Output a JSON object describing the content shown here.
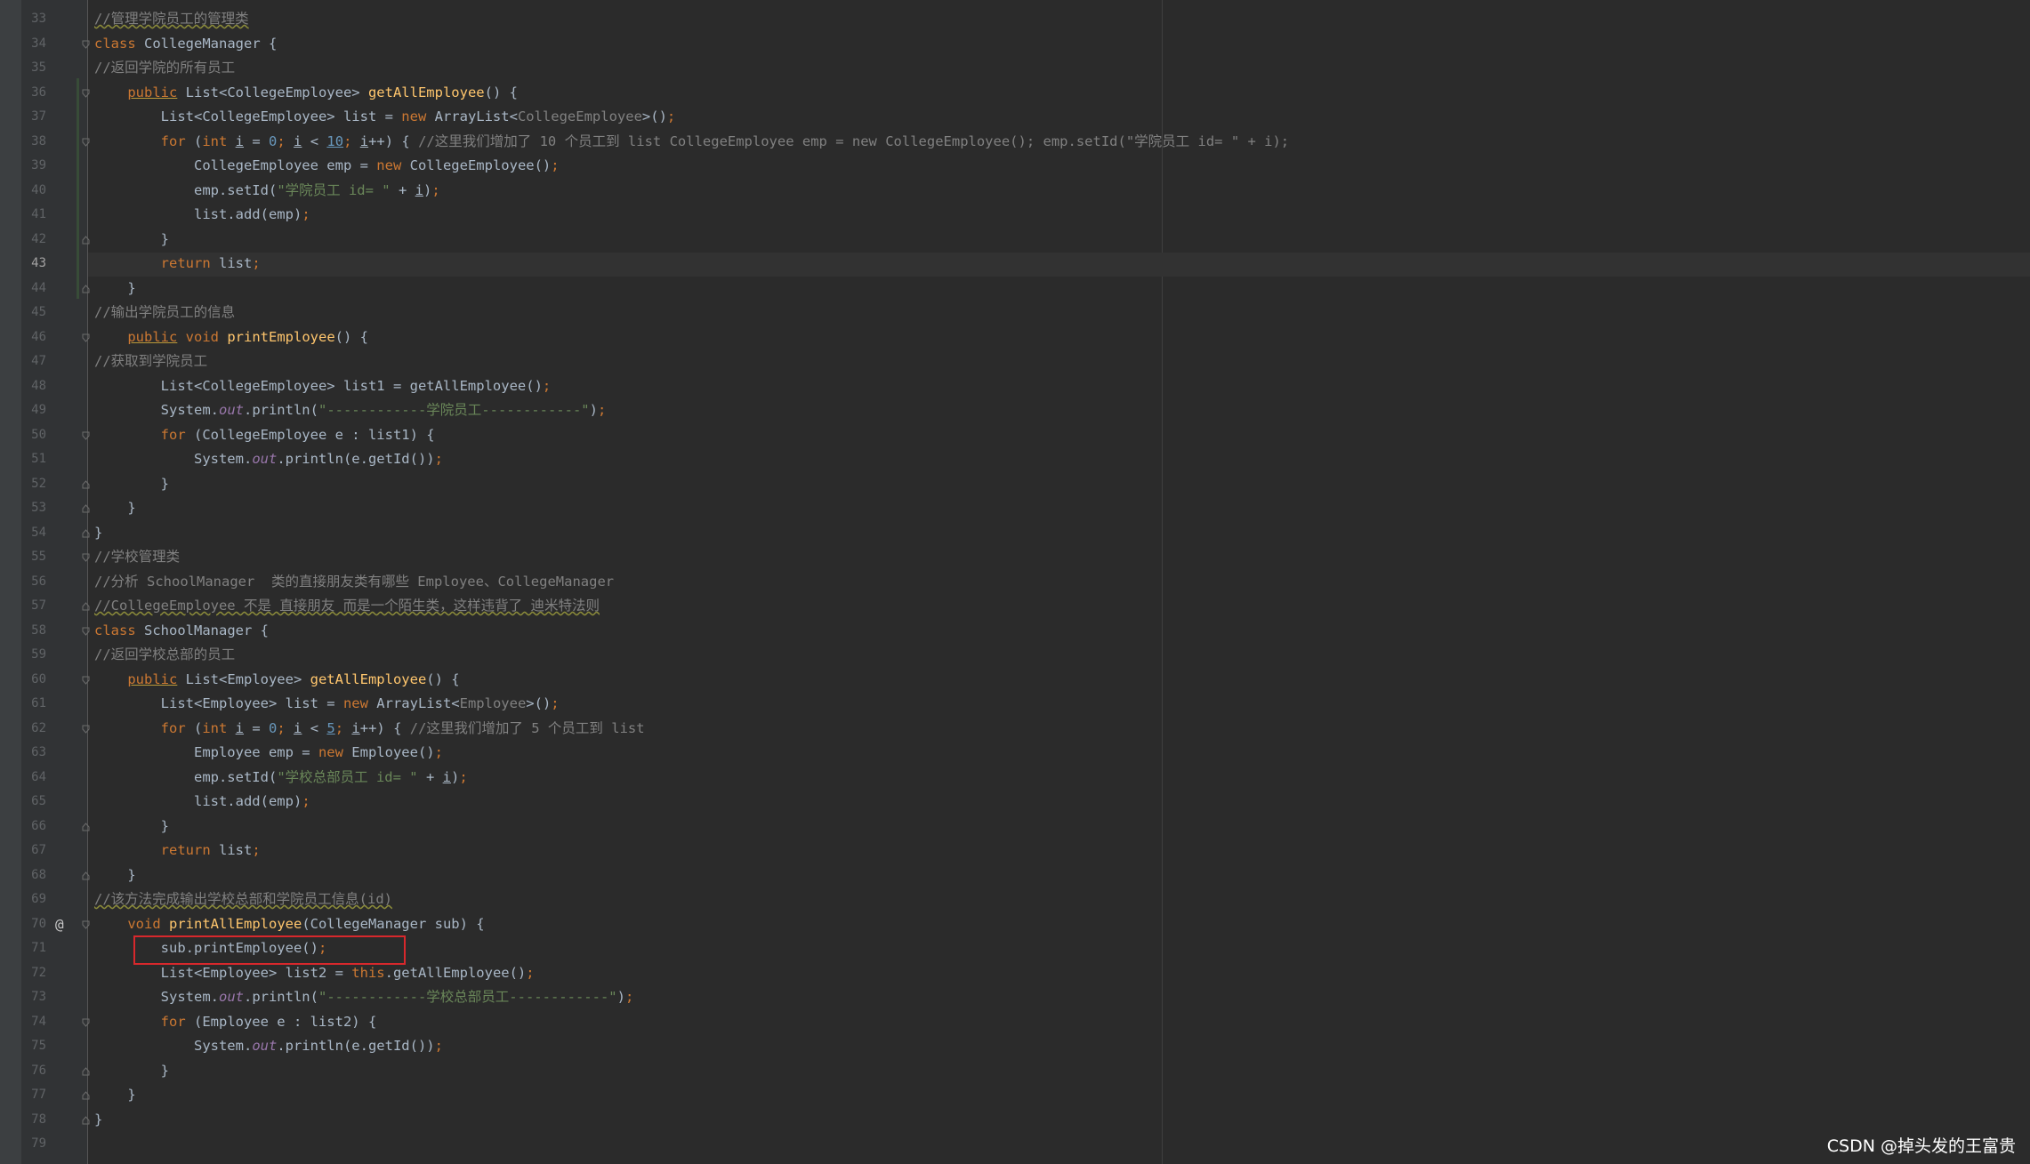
{
  "editor": {
    "active_line": "43",
    "watermark": "CSDN @掉头发的王富贵",
    "line_numbers": [
      "33",
      "34",
      "35",
      "36",
      "37",
      "38",
      "39",
      "40",
      "41",
      "42",
      "43",
      "44",
      "45",
      "46",
      "47",
      "48",
      "49",
      "50",
      "51",
      "52",
      "53",
      "54",
      "55",
      "56",
      "57",
      "58",
      "59",
      "60",
      "61",
      "62",
      "63",
      "64",
      "65",
      "66",
      "67",
      "68",
      "69",
      "70",
      "71",
      "72",
      "73",
      "74",
      "75",
      "76",
      "77",
      "78",
      "79"
    ],
    "gutter_marker_line70": "@",
    "code": {
      "l33": "//管理学院员工的管理类",
      "l34_kw": "class",
      "l34_rest": " CollegeManager {",
      "l35": "//返回学院的所有员工",
      "l36_kw": "public",
      "l36_type": " List<CollegeEmployee> ",
      "l36_fn": "getAllEmployee",
      "l36_rest": "() {",
      "l37_a": "List<CollegeEmployee> list = ",
      "l37_kw": "new",
      "l37_b": " ArrayList<",
      "l37_gen": "CollegeEmployee",
      "l37_c": ">()",
      "l37_semi": ";",
      "l38_kw1": "for",
      "l38_a": " (",
      "l38_kw2": "int",
      "l38_var1": "i",
      "l38_b": " = ",
      "l38_n0": "0",
      "l38_semi1": ";",
      "l38_var2": "i",
      "l38_c": " < ",
      "l38_n10": "10",
      "l38_semi2": ";",
      "l38_var3": "i",
      "l38_d": "++) { ",
      "l38_cm": "//这里我们增加了 10 个员工到 list CollegeEmployee emp = new CollegeEmployee(); emp.setId(\"学院员工 id= \" + i);",
      "l39_a": "CollegeEmployee emp = ",
      "l39_kw": "new",
      "l39_b": " CollegeEmployee()",
      "l39_semi": ";",
      "l40_a": "emp.setId(",
      "l40_st": "\"学院员工 id= \"",
      "l40_b": " + ",
      "l40_var": "i",
      "l40_c": ")",
      "l40_semi": ";",
      "l41_a": "list.add(emp)",
      "l41_semi": ";",
      "l42": "}",
      "l43_kw": "return",
      "l43_a": " list",
      "l43_semi": ";",
      "l44": "}",
      "l45": "//输出学院员工的信息",
      "l46_kw1": "public",
      "l46_kw2": "void",
      "l46_fn": "printEmployee",
      "l46_rest": "() {",
      "l47": "//获取到学院员工",
      "l48_a": "List<CollegeEmployee> list1 = getAllEmployee()",
      "l48_semi": ";",
      "l49_a": "System.",
      "l49_fld": "out",
      "l49_b": ".println(",
      "l49_st": "\"------------学院员工------------\"",
      "l49_c": ")",
      "l49_semi": ";",
      "l50_kw": "for",
      "l50_rest": " (CollegeEmployee e : list1) {",
      "l51_a": "System.",
      "l51_fld": "out",
      "l51_b": ".println(e.getId())",
      "l51_semi": ";",
      "l52": "}",
      "l53": "}",
      "l54": "}",
      "l55": "//学校管理类",
      "l56": "//分析 SchoolManager  类的直接朋友类有哪些 Employee、CollegeManager",
      "l57": "//CollegeEmployee 不是 直接朋友 而是一个陌生类，这样违背了 迪米特法则",
      "l58_kw": "class",
      "l58_rest": " SchoolManager {",
      "l59": "//返回学校总部的员工",
      "l60_kw": "public",
      "l60_type": " List<Employee> ",
      "l60_fn": "getAllEmployee",
      "l60_rest": "() {",
      "l61_a": "List<Employee> list = ",
      "l61_kw": "new",
      "l61_b": " ArrayList<",
      "l61_gen": "Employee",
      "l61_c": ">()",
      "l61_semi": ";",
      "l62_kw1": "for",
      "l62_a": " (",
      "l62_kw2": "int",
      "l62_var1": "i",
      "l62_b": " = ",
      "l62_n0": "0",
      "l62_semi1": ";",
      "l62_var2": "i",
      "l62_c": " < ",
      "l62_n5": "5",
      "l62_semi2": ";",
      "l62_var3": "i",
      "l62_d": "++) { ",
      "l62_cm": "//这里我们增加了 5 个员工到 list",
      "l63_a": "Employee emp = ",
      "l63_kw": "new",
      "l63_b": " Employee()",
      "l63_semi": ";",
      "l64_a": "emp.setId(",
      "l64_st": "\"学校总部员工 id= \"",
      "l64_b": " + ",
      "l64_var": "i",
      "l64_c": ")",
      "l64_semi": ";",
      "l65_a": "list.add(emp)",
      "l65_semi": ";",
      "l66": "}",
      "l67_kw": "return",
      "l67_a": " list",
      "l67_semi": ";",
      "l68": "}",
      "l69": "//该方法完成输出学校总部和学院员工信息(id)",
      "l70_kw": "void",
      "l70_fn": "printAllEmployee",
      "l70_rest": "(CollegeManager sub) {",
      "l71_a": "sub.printEmployee()",
      "l71_semi": ";",
      "l72_a": "List<Employee> list2 = ",
      "l72_kw": "this",
      "l72_b": ".getAllEmployee()",
      "l72_semi": ";",
      "l73_a": "System.",
      "l73_fld": "out",
      "l73_b": ".println(",
      "l73_st": "\"------------学校总部员工------------\"",
      "l73_c": ")",
      "l73_semi": ";",
      "l74_kw": "for",
      "l74_rest": " (Employee e : list2) {",
      "l75_a": "System.",
      "l75_fld": "out",
      "l75_b": ".println(e.getId())",
      "l75_semi": ";",
      "l76": "}",
      "l77": "}",
      "l78": "}"
    }
  }
}
